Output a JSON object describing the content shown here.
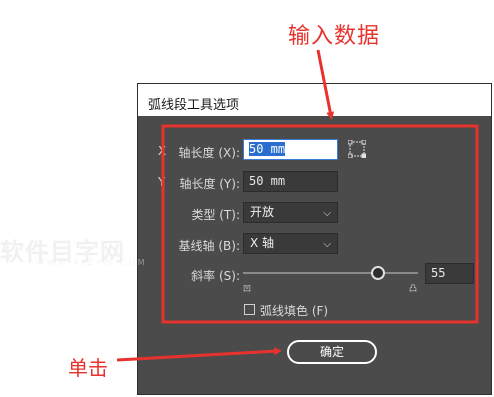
{
  "annotations": {
    "top_text": "输入数据",
    "left_text": "单击"
  },
  "dialog": {
    "title": "弧线段工具选项",
    "x_axis_length": {
      "cut_prefix": "X",
      "label": "轴长度 (X):",
      "value": "50 mm"
    },
    "y_axis_length": {
      "cut_prefix": "Y",
      "label": "轴长度 (Y):",
      "value": "50 mm"
    },
    "type": {
      "label": "类型 (T):",
      "value": "开放"
    },
    "base_axis": {
      "label": "基线轴 (B):",
      "value": "X 轴"
    },
    "slope": {
      "label": "斜率 (S):",
      "value": "55",
      "level_fraction": 0.77,
      "left_caption": "凹",
      "right_caption": "凸"
    },
    "fill_arc": {
      "label": "弧线填色 (F)",
      "checked": false
    },
    "ok_label": "确定"
  },
  "watermark": {
    "main": "软件目字网",
    "sub": "WWW.RJZXW.COM"
  },
  "colors": {
    "annotation": "#e8322d",
    "dialog_bg": "#4b4b4b",
    "focus_blue": "#2a6fd0"
  },
  "icons": {
    "arc_origin": "reference-point-icon",
    "dropdown": "chevron-down-icon"
  }
}
